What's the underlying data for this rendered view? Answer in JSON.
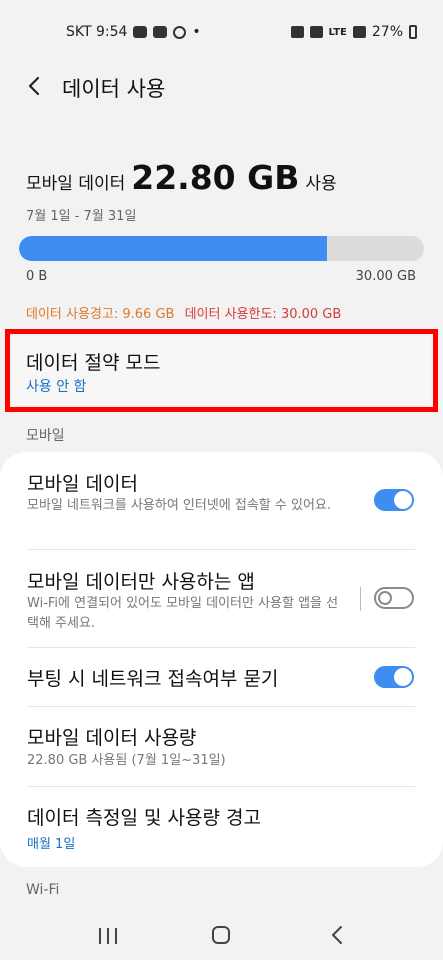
{
  "status_bar": {
    "carrier_time": "SKT 9:54",
    "network": "LTE",
    "battery": "27%"
  },
  "header": {
    "title": "데이터 사용"
  },
  "usage": {
    "prefix": "모바일 데이터",
    "amount": "22.80 GB",
    "suffix": "사용",
    "period": "7월 1일 - 7월 31일",
    "fill_fraction": 0.76,
    "min_label": "0 B",
    "max_label": "30.00 GB",
    "warning_text": "데이터 사용경고: 9.66 GB",
    "limit_text": "데이터 사용한도: 30.00 GB"
  },
  "data_saver": {
    "title": "데이터 절약 모드",
    "status": "사용 안 함"
  },
  "sections": {
    "mobile": "모바일",
    "wifi": "Wi-Fi"
  },
  "settings": {
    "mobile_data": {
      "title": "모바일 데이터",
      "desc": "모바일 네트워크를 사용하여 인터넷에 접속할 수 있어요.",
      "enabled": true
    },
    "mobile_only_apps": {
      "title": "모바일 데이터만 사용하는 앱",
      "desc": "Wi-Fi에 연결되어 있어도 모바일 데이터만 사용할 앱을 선택해 주세요.",
      "enabled": false
    },
    "boot_network_prompt": {
      "title": "부팅 시 네트워크 접속여부 묻기",
      "enabled": true
    },
    "mobile_data_usage": {
      "title": "모바일 데이터 사용량",
      "desc": "22.80 GB 사용됨 (7월 1일~31일)"
    },
    "billing_cycle": {
      "title": "데이터 측정일 및 사용량 경고",
      "sub": "매월 1일"
    }
  },
  "colors": {
    "accent": "#3e8df0",
    "warning": "#e07a2c",
    "limit": "#d63b3b",
    "link": "#1a6fc2",
    "highlight": "#ff0000"
  },
  "icons": {
    "back": "chevron-left-icon",
    "nav_recent": "recent-apps-icon",
    "nav_home": "home-icon",
    "nav_back": "nav-back-icon"
  }
}
